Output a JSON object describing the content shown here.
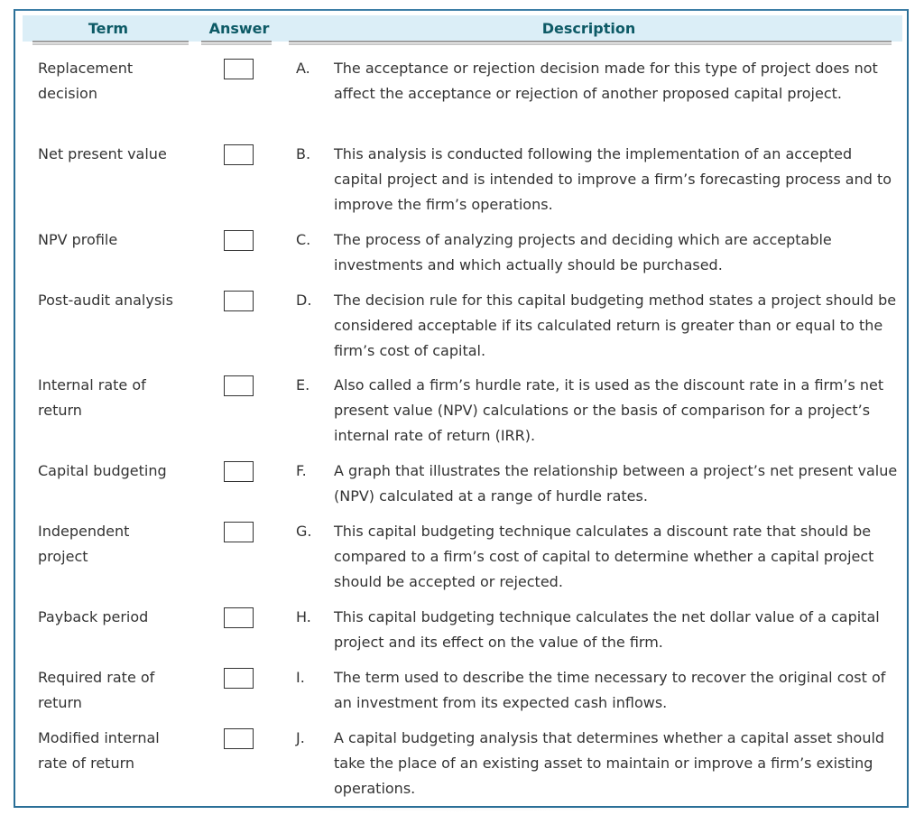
{
  "header": {
    "term": "Term",
    "answer": "Answer",
    "description": "Description"
  },
  "rows": [
    {
      "term": "Replacement decision",
      "answer": "",
      "letter": "A.",
      "description": "The acceptance or rejection decision made for this type of project does not affect the acceptance or rejection of another proposed capital project."
    },
    {
      "term": "Net present value",
      "answer": "",
      "letter": "B.",
      "description": "This analysis is conducted following the implementation of an accepted capital project and is intended to improve a firm’s forecasting process and to improve the firm’s operations."
    },
    {
      "term": "NPV profile",
      "answer": "",
      "letter": "C.",
      "description": "The process of analyzing projects and deciding which are acceptable investments and which actually should be purchased."
    },
    {
      "term": "Post-audit analysis",
      "answer": "",
      "letter": "D.",
      "description": "The decision rule for this capital budgeting method states a project should be considered acceptable if its calculated return is greater than or equal to the firm’s cost of capital."
    },
    {
      "term": "Internal rate of return",
      "answer": "",
      "letter": "E.",
      "description": "Also called a firm’s hurdle rate, it is used as the discount rate in a firm’s net present value (NPV) calculations or the basis of comparison for a project’s internal rate of return (IRR)."
    },
    {
      "term": "Capital budgeting",
      "answer": "",
      "letter": "F.",
      "description": "A graph that illustrates the relationship between a project’s net present value (NPV) calculated at a range of hurdle rates."
    },
    {
      "term": "Independent project",
      "answer": "",
      "letter": "G.",
      "description": "This capital budgeting technique calculates a discount rate that should be compared to a firm’s cost of capital to determine whether a capital project should be accepted or rejected."
    },
    {
      "term": "Payback period",
      "answer": "",
      "letter": "H.",
      "description": "This capital budgeting technique calculates the net dollar value of a capital project and its effect on the value of the firm."
    },
    {
      "term": "Required rate of return",
      "answer": "",
      "letter": "I.",
      "description": "The term used to describe the time necessary to recover the original cost of an investment from its expected cash inflows."
    },
    {
      "term": "Modified internal rate of return",
      "answer": "",
      "letter": "J.",
      "description": "A capital budgeting analysis that determines whether a capital asset should take the place of an existing asset to maintain or improve a firm’s existing operations."
    }
  ]
}
